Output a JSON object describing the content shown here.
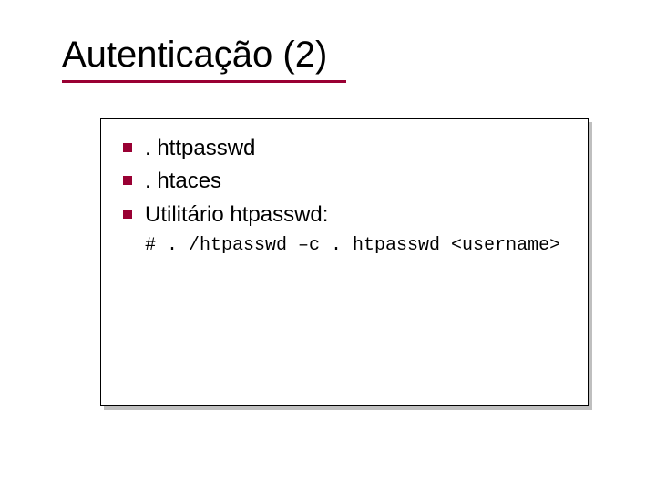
{
  "title": "Autenticação (2)",
  "bullets": [
    {
      "text": ". httpasswd"
    },
    {
      "text": ". htaces"
    },
    {
      "text": "Utilitário htpasswd:"
    }
  ],
  "code": "# . /htpasswd –c . htpasswd <username>"
}
